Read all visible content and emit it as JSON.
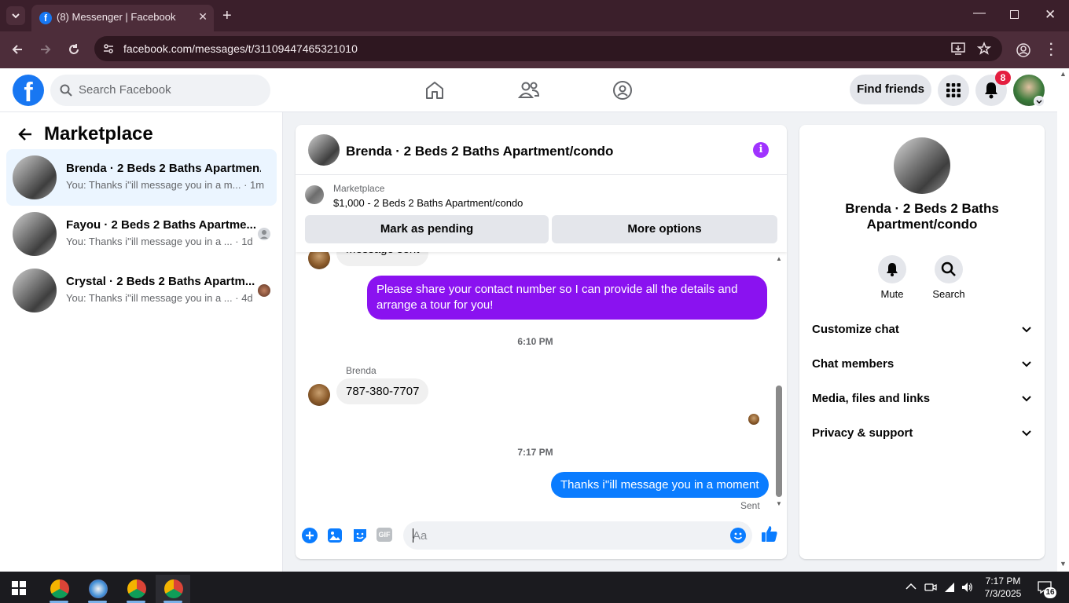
{
  "browser": {
    "tab_title": "(8) Messenger | Facebook",
    "url": "facebook.com/messages/t/31109447465321010"
  },
  "header": {
    "search_placeholder": "Search Facebook",
    "find_friends": "Find friends",
    "notification_count": "8"
  },
  "sidebar": {
    "title": "Marketplace",
    "conversations": [
      {
        "name": "Brenda · 2 Beds 2 Baths Apartmen...",
        "preview": "You: Thanks i''ill message you in a m...",
        "time": "· 1m"
      },
      {
        "name": "Fayou · 2 Beds 2 Baths Apartme...",
        "preview": "You: Thanks i''ill message you in a ...",
        "time": "· 1d"
      },
      {
        "name": "Crystal · 2 Beds 2 Baths Apartm...",
        "preview": "You: Thanks i''ill message you in a ...",
        "time": "· 4d"
      }
    ]
  },
  "chat": {
    "title": "Brenda · 2 Beds 2 Baths Apartment/condo",
    "marketplace_label": "Marketplace",
    "listing": "$1,000 - 2 Beds 2 Baths Apartment/condo",
    "mark_pending": "Mark as pending",
    "more_options": "More options",
    "partial_msg": "Message sent",
    "out_msg": "Please share your contact number so I can provide all the details and arrange a tour for you!",
    "ts1": "6:10 PM",
    "sender": "Brenda",
    "in_msg": "787-380-7707",
    "ts2": "7:17 PM",
    "last_msg": "Thanks i''ill message you in a moment",
    "status": "Sent",
    "input_placeholder": "Aa"
  },
  "info_panel": {
    "name": "Brenda · 2 Beds 2 Baths Apartment/condo",
    "mute": "Mute",
    "search": "Search",
    "sections": [
      "Customize chat",
      "Chat members",
      "Media, files and links",
      "Privacy & support"
    ]
  },
  "taskbar": {
    "time": "7:17 PM",
    "date": "7/3/2025",
    "notif_count": "16"
  },
  "colors": {
    "fb_blue": "#1877f2",
    "messenger_purple": "#8a12f0",
    "messenger_blue": "#0a7cff",
    "badge_red": "#e41e3f"
  }
}
